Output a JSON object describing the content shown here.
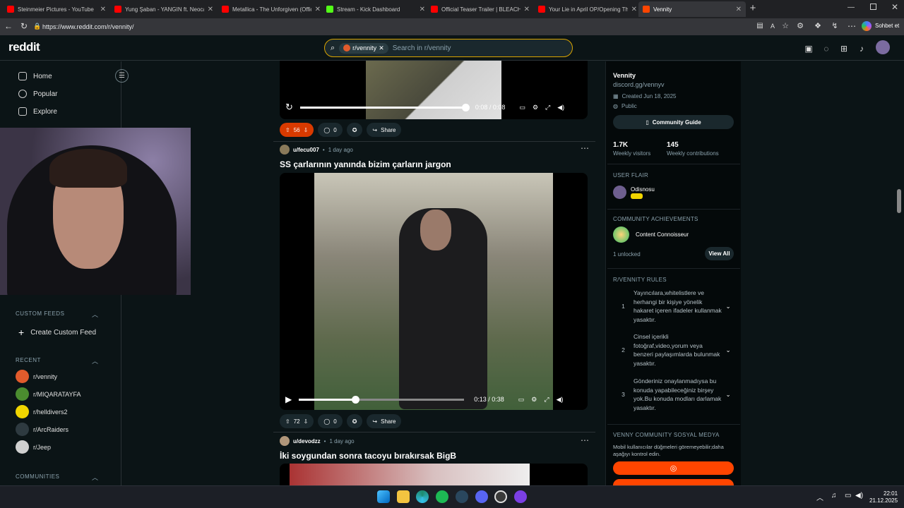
{
  "browser": {
    "tabs": [
      {
        "title": "Steinmeier Pictures - YouTube",
        "color": "#ff0000"
      },
      {
        "title": "Yung Şaban - YANGIN ft. Neocastle",
        "color": "#ff0000"
      },
      {
        "title": "Metallica - The Unforgiven (Official",
        "color": "#ff0000"
      },
      {
        "title": "Stream - Kick Dashboard",
        "color": "#53fc18"
      },
      {
        "title": "Official Teaser Trailer | BLEACH: Th",
        "color": "#ff0000"
      },
      {
        "title": "Your Lie in April OP/Opening Them",
        "color": "#ff0000"
      },
      {
        "title": "Vennity",
        "color": "#ff4500"
      }
    ],
    "url": "https://www.reddit.com/r/vennity/",
    "profile_label": "Sohbet et"
  },
  "header": {
    "logo": "reddit",
    "search_chip": "r/vennity",
    "search_placeholder": "Search in r/vennity"
  },
  "left_sidebar": {
    "nav": [
      {
        "label": "Home",
        "icon": "home-icon"
      },
      {
        "label": "Popular",
        "icon": "popular-icon"
      },
      {
        "label": "Explore",
        "icon": "explore-icon"
      }
    ],
    "custom_feeds_heading": "CUSTOM FEEDS",
    "create_custom_feed": "Create Custom Feed",
    "recent_heading": "RECENT",
    "recent": [
      {
        "name": "r/vennity",
        "color": "#e25b2c"
      },
      {
        "name": "r/MIQARATAYFA",
        "color": "#4b8c2f"
      },
      {
        "name": "r/helldivers2",
        "color": "#f1d500"
      },
      {
        "name": "r/ArcRaiders",
        "color": "#2e3a40"
      },
      {
        "name": "r/Jeep",
        "color": "#d0d0d0"
      }
    ],
    "communities_heading": "COMMUNITIES"
  },
  "feed": {
    "post1": {
      "time": "0:08 / 0:08",
      "progress": 1.0,
      "votes": "56",
      "comments": "0",
      "share": "Share"
    },
    "post2": {
      "user": "u/fecu007",
      "age": "1 day ago",
      "title": "SS çarlarının yanında bizim çarların jargon",
      "time": "0:13 / 0:38",
      "progress": 0.34,
      "votes": "72",
      "comments": "0",
      "share": "Share"
    },
    "post3": {
      "user": "u/devodzz",
      "age": "1 day ago",
      "title": "İki soygundan sonra tacoyu bırakırsak BigB"
    }
  },
  "right_sidebar": {
    "name": "Vennity",
    "link": "discord.gg/vennyv",
    "created": "Created Jun 18, 2025",
    "visibility": "Public",
    "guide_button": "Community Guide",
    "visitors_value": "1.7K",
    "visitors_label": "Weekly visitors",
    "contrib_value": "145",
    "contrib_label": "Weekly contributions",
    "flair_heading": "USER FLAIR",
    "flair_user": "Odisnosu",
    "achievements_heading": "COMMUNITY ACHIEVEMENTS",
    "achievement": "Content Connoisseur",
    "unlocked": "1 unlocked",
    "view_all": "View All",
    "rules_heading": "R/VENNITY RULES",
    "rules": [
      {
        "n": "1",
        "text": "Yayıncılara,whitelistlere ve herhangi bir kişiye yönelik hakaret içeren ifadeler kullanmak yasaktır."
      },
      {
        "n": "2",
        "text": "Cinsel içerikli fotoğraf,video,yorum veya benzeri paylaşımlarda bulunmak yasaktır."
      },
      {
        "n": "3",
        "text": "Gönderiniz onaylanmadıysa bu konuda yapabileceğiniz birşey yok.Bu konuda modları darlamak yasaktır."
      }
    ],
    "social_heading": "VENNY COMMUNITY SOSYAL MEDYA",
    "social_note": "Mobil kullanıcılar düğmeleri göremeyebilir;daha aşağıyı kontrol edin."
  },
  "taskbar": {
    "time": "22:01",
    "date": "21.12.2025"
  }
}
